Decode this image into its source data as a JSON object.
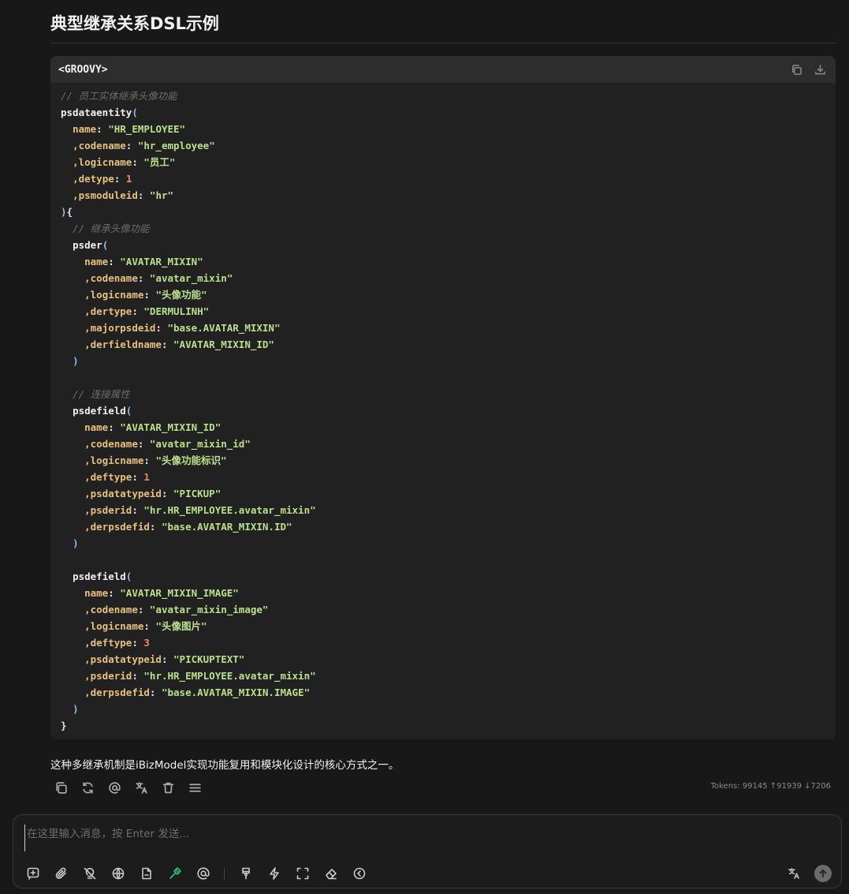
{
  "heading": "典型继承关系DSL示例",
  "code": {
    "language": "<GROOVY>",
    "lines": {
      "l1": "// 员工实体继承头像功能",
      "l2_fn": "psdataentity",
      "l3_key": "name",
      "l3_val": "\"HR_EMPLOYEE\"",
      "l4_key": ",codename",
      "l4_val": "\"hr_employee\"",
      "l5_key": ",logicname",
      "l5_val": "\"员工\"",
      "l6_key": ",detype",
      "l6_val": "1",
      "l7_key": ",psmoduleid",
      "l7_val": "\"hr\"",
      "l9": "// 继承头像功能",
      "l10_fn": "psder",
      "l11_key": "name",
      "l11_val": "\"AVATAR_MIXIN\"",
      "l12_key": ",codename",
      "l12_val": "\"avatar_mixin\"",
      "l13_key": ",logicname",
      "l13_val": "\"头像功能\"",
      "l14_key": ",dertype",
      "l14_val": "\"DERMULINH\"",
      "l15_key": ",majorpsdeid",
      "l15_val": "\"base.AVATAR_MIXIN\"",
      "l16_key": ",derfieldname",
      "l16_val": "\"AVATAR_MIXIN_ID\"",
      "l19": "// 连接属性",
      "l20_fn": "psdefield",
      "l21_key": "name",
      "l21_val": "\"AVATAR_MIXIN_ID\"",
      "l22_key": ",codename",
      "l22_val": "\"avatar_mixin_id\"",
      "l23_key": ",logicname",
      "l23_val": "\"头像功能标识\"",
      "l24_key": ",deftype",
      "l24_val": "1",
      "l25_key": ",psdatatypeid",
      "l25_val": "\"PICKUP\"",
      "l26_key": ",psderid",
      "l26_val": "\"hr.HR_EMPLOYEE.avatar_mixin\"",
      "l27_key": ",derpsdefid",
      "l27_val": "\"base.AVATAR_MIXIN.ID\"",
      "l30_fn": "psdefield",
      "l31_key": "name",
      "l31_val": "\"AVATAR_MIXIN_IMAGE\"",
      "l32_key": ",codename",
      "l32_val": "\"avatar_mixin_image\"",
      "l33_key": ",logicname",
      "l33_val": "\"头像图片\"",
      "l34_key": ",deftype",
      "l34_val": "3",
      "l35_key": ",psdatatypeid",
      "l35_val": "\"PICKUPTEXT\"",
      "l36_key": ",psderid",
      "l36_val": "\"hr.HR_EMPLOYEE.avatar_mixin\"",
      "l37_key": ",derpsdefid",
      "l37_val": "\"base.AVATAR_MIXIN.IMAGE\""
    }
  },
  "summary": "这种多继承机制是iBizModel实现功能复用和模块化设计的核心方式之一。",
  "tokens": "Tokens: 99145 ↑91939 ↓7206",
  "composer": {
    "placeholder": "在这里输入消息，按 Enter 发送..."
  },
  "icons": {
    "code_actions": [
      "copy-icon",
      "download-icon"
    ],
    "message_actions": [
      "copy-icon",
      "refresh-icon",
      "at-icon",
      "translate-icon",
      "trash-icon",
      "menu-icon"
    ],
    "toolbar": [
      "new-topic-icon",
      "paperclip-icon",
      "lightbulb-off-icon",
      "globe-icon",
      "file-icon",
      "hammer-icon",
      "at-icon",
      "brush-icon",
      "lightning-icon",
      "fullscreen-icon",
      "eraser-icon",
      "chevron-left-circle-icon"
    ],
    "right_tools": [
      "translate-icon",
      "send-icon"
    ]
  },
  "colors": {
    "background": "#181818",
    "code_bg": "#212121",
    "code_header_bg": "#2d2d2d",
    "key": "#e8c07d",
    "string": "#b9e08a",
    "number": "#f08a5d",
    "paren": "#8fbfe8",
    "comment": "#6c6c6c",
    "active_tool": "#2fbf71"
  }
}
